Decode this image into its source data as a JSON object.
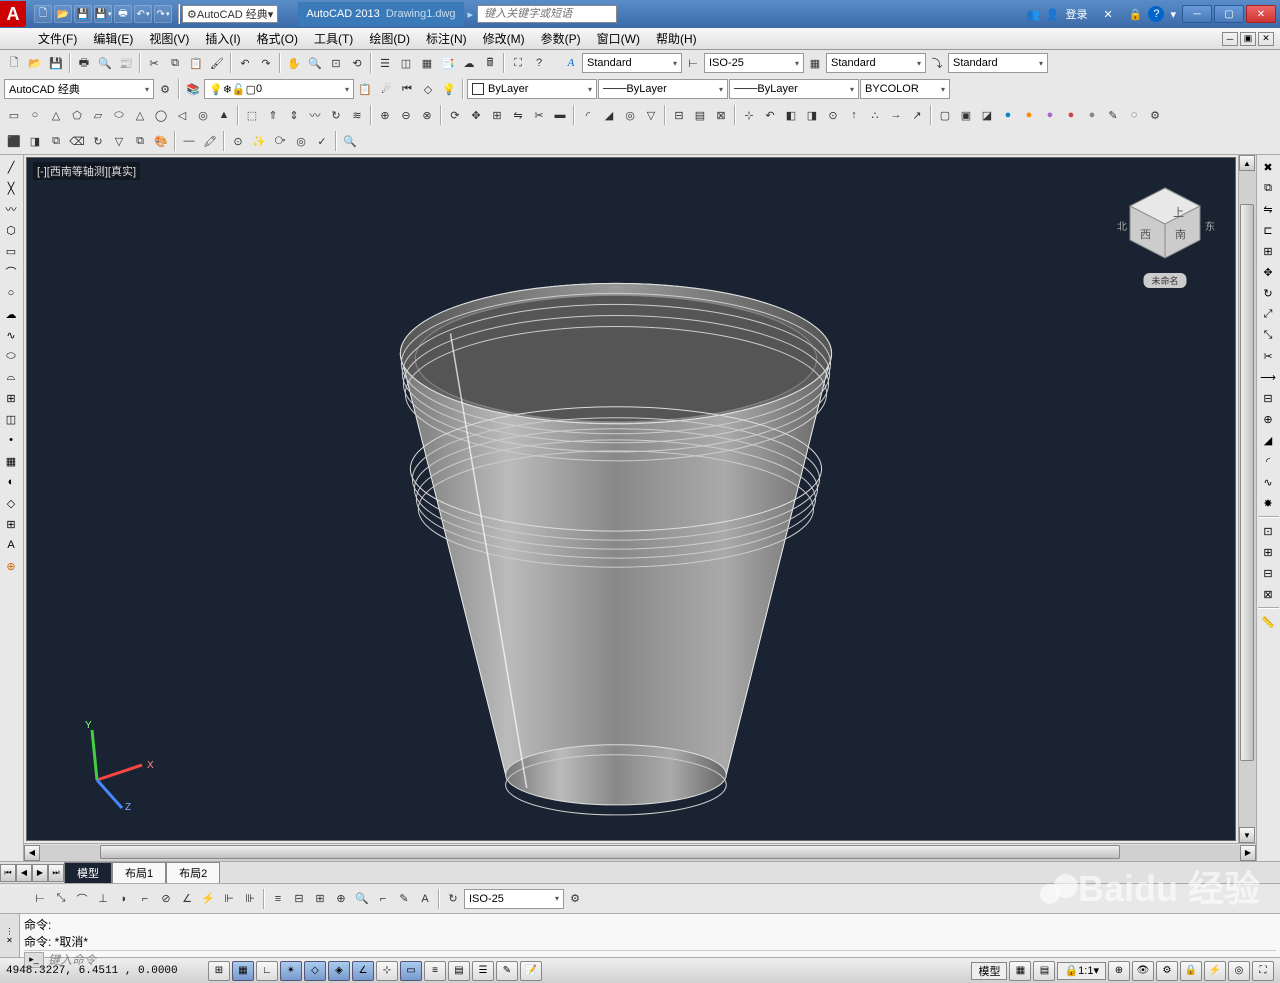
{
  "title": {
    "app": "AutoCAD 2013",
    "doc": "Drawing1.dwg",
    "search_ph": "键入关键字或短语",
    "login": "登录",
    "workspace": "AutoCAD 经典"
  },
  "menu": [
    "文件(F)",
    "编辑(E)",
    "视图(V)",
    "插入(I)",
    "格式(O)",
    "工具(T)",
    "绘图(D)",
    "标注(N)",
    "修改(M)",
    "参数(P)",
    "窗口(W)",
    "帮助(H)"
  ],
  "row1": {
    "text_style": "Standard",
    "dim_style": "ISO-25",
    "table_style": "Standard",
    "mleader_style": "Standard"
  },
  "row2": {
    "workspace": "AutoCAD 经典",
    "layer_label": "0",
    "color": "ByLayer",
    "linetype": "ByLayer",
    "lineweight": "ByLayer",
    "plot_style": "BYCOLOR"
  },
  "viewport": {
    "label": "[-][西南等轴测][真实]",
    "viewcube_hint": "未命名"
  },
  "tabs": {
    "model": "模型",
    "layout1": "布局1",
    "layout2": "布局2"
  },
  "dim_combo": "ISO-25",
  "cmd": {
    "l1": "命令:",
    "l2": "命令: *取消*",
    "input_ph": "键入命令"
  },
  "status": {
    "coords": "4948.3227, 6.4511 , 0.0000",
    "model": "模型",
    "scale": "1:1"
  },
  "watermark": {
    "main": "Baidu 经验",
    "sub": "jingyan.baidu.com"
  }
}
